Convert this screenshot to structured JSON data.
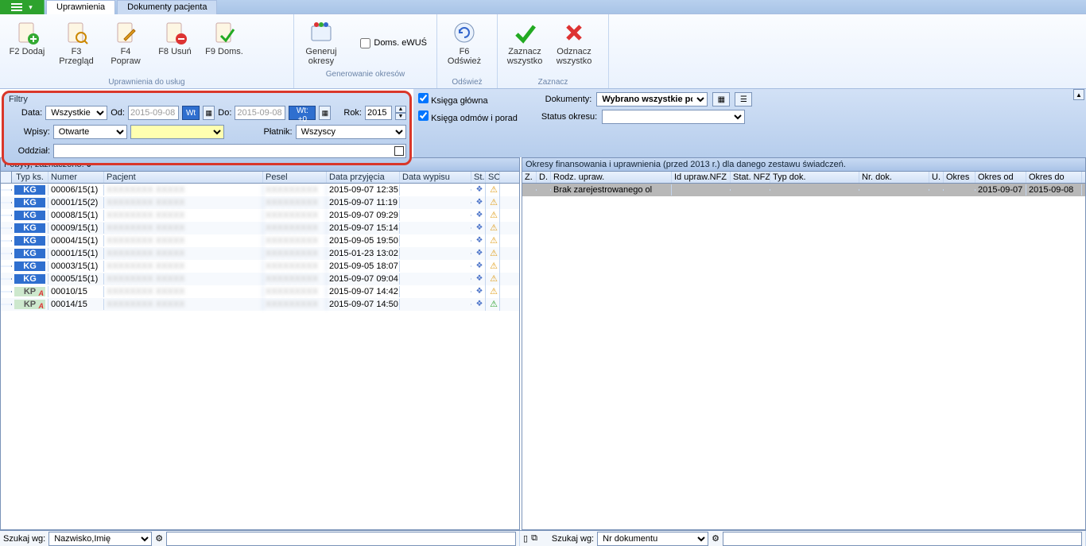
{
  "tabs": {
    "active": "Uprawnienia",
    "inactive": "Dokumenty pacjenta"
  },
  "ribbon": {
    "group1": {
      "label": "Uprawnienia do usług",
      "dodaj": "F2  Dodaj",
      "przeglad": "F3  Przegląd",
      "popraw": "F4  Popraw",
      "usun": "F8  Usuń",
      "doms": "F9  Doms."
    },
    "group2": {
      "label": "Generowanie okresów",
      "generuj": "Generuj\nokresy",
      "checkbox": "Doms. eWUŚ"
    },
    "group3": {
      "label": "Odśwież",
      "odswiez": "F6  Odśwież"
    },
    "group4": {
      "label": "Zaznacz",
      "zazn": "Zaznacz\nwszystko",
      "odzn": "Odznacz\nwszystko"
    }
  },
  "filters": {
    "title": "Filtry",
    "data_label": "Data:",
    "data_value": "Wszystkie",
    "od_label": "Od:",
    "od_value": "2015-09-08",
    "od_wt": "Wt",
    "do_label": "Do:",
    "do_value": "2015-09-08",
    "do_wt": "Wt: +0",
    "rok_label": "Rok:",
    "rok_value": "2015",
    "wpisy_label": "Wpisy:",
    "wpisy_value": "Otwarte",
    "platnik_label": "Płatnik:",
    "platnik_value": "Wszyscy",
    "oddzial_label": "Oddział:"
  },
  "right_filters": {
    "ks_glowna": "Księga główna",
    "ks_odmow": "Księga odmów i porad",
    "dokumenty_label": "Dokumenty:",
    "dokumenty_value": "Wybrano wszystkie pozycje",
    "status_label": "Status okresu:"
  },
  "left_pane": {
    "header_prefix": "Pobyty, zaznaczono: ",
    "header_count": "0",
    "cols": {
      "typ": "Typ ks.",
      "numer": "Numer",
      "pacjent": "Pacjent",
      "pesel": "Pesel",
      "dpr": "Data przyjęcia",
      "dwy": "Data wypisu",
      "st": "St.",
      "so": "SO"
    },
    "rows": [
      {
        "typ": "KG",
        "numer": "00006/15(1)",
        "dpr": "2015-09-07 12:35",
        "dwy": "",
        "so": "warn"
      },
      {
        "typ": "KG",
        "numer": "00001/15(2)",
        "dpr": "2015-09-07 11:19",
        "dwy": "",
        "so": "warn"
      },
      {
        "typ": "KG",
        "numer": "00008/15(1)",
        "dpr": "2015-09-07 09:29",
        "dwy": "",
        "so": "warn"
      },
      {
        "typ": "KG",
        "numer": "00009/15(1)",
        "dpr": "2015-09-07 15:14",
        "dwy": "",
        "so": "warn"
      },
      {
        "typ": "KG",
        "numer": "00004/15(1)",
        "dpr": "2015-09-05 19:50",
        "dwy": "",
        "so": "warn"
      },
      {
        "typ": "KG",
        "numer": "00001/15(1)",
        "dpr": "2015-01-23 13:02",
        "dwy": "",
        "so": "warn"
      },
      {
        "typ": "KG",
        "numer": "00003/15(1)",
        "dpr": "2015-09-05 18:07",
        "dwy": "",
        "so": "warn"
      },
      {
        "typ": "KG",
        "numer": "00005/15(1)",
        "dpr": "2015-09-07 09:04",
        "dwy": "",
        "so": "warn"
      },
      {
        "typ": "KPA",
        "numer": "00010/15",
        "dpr": "2015-09-07 14:42",
        "dwy": "",
        "so": "warn"
      },
      {
        "typ": "KPA",
        "numer": "00014/15",
        "dpr": "2015-09-07 14:50",
        "dwy": "",
        "so": "ok"
      }
    ]
  },
  "right_pane": {
    "header": "Okresy finansowania i uprawnienia (przed 2013 r.) dla danego zestawu świadczeń.",
    "cols": {
      "z": "Z.",
      "d": "D.",
      "ru": "Rodz. upraw.",
      "id": "Id upraw.NFZ",
      "sn": "Stat. NFZ",
      "td": "Typ dok.",
      "nd": "Nr. dok.",
      "u": "U.",
      "ok": "Okres",
      "ood": "Okres od",
      "odo": "Okres do"
    },
    "rows": [
      {
        "ru": "Brak zarejestrowanego ol",
        "ood": "2015-09-07",
        "odo": "2015-09-08"
      }
    ]
  },
  "statusbar": {
    "left_label": "Szukaj wg:",
    "left_value": "Nazwisko,Imię",
    "right_label": "Szukaj wg:",
    "right_value": "Nr dokumentu"
  }
}
